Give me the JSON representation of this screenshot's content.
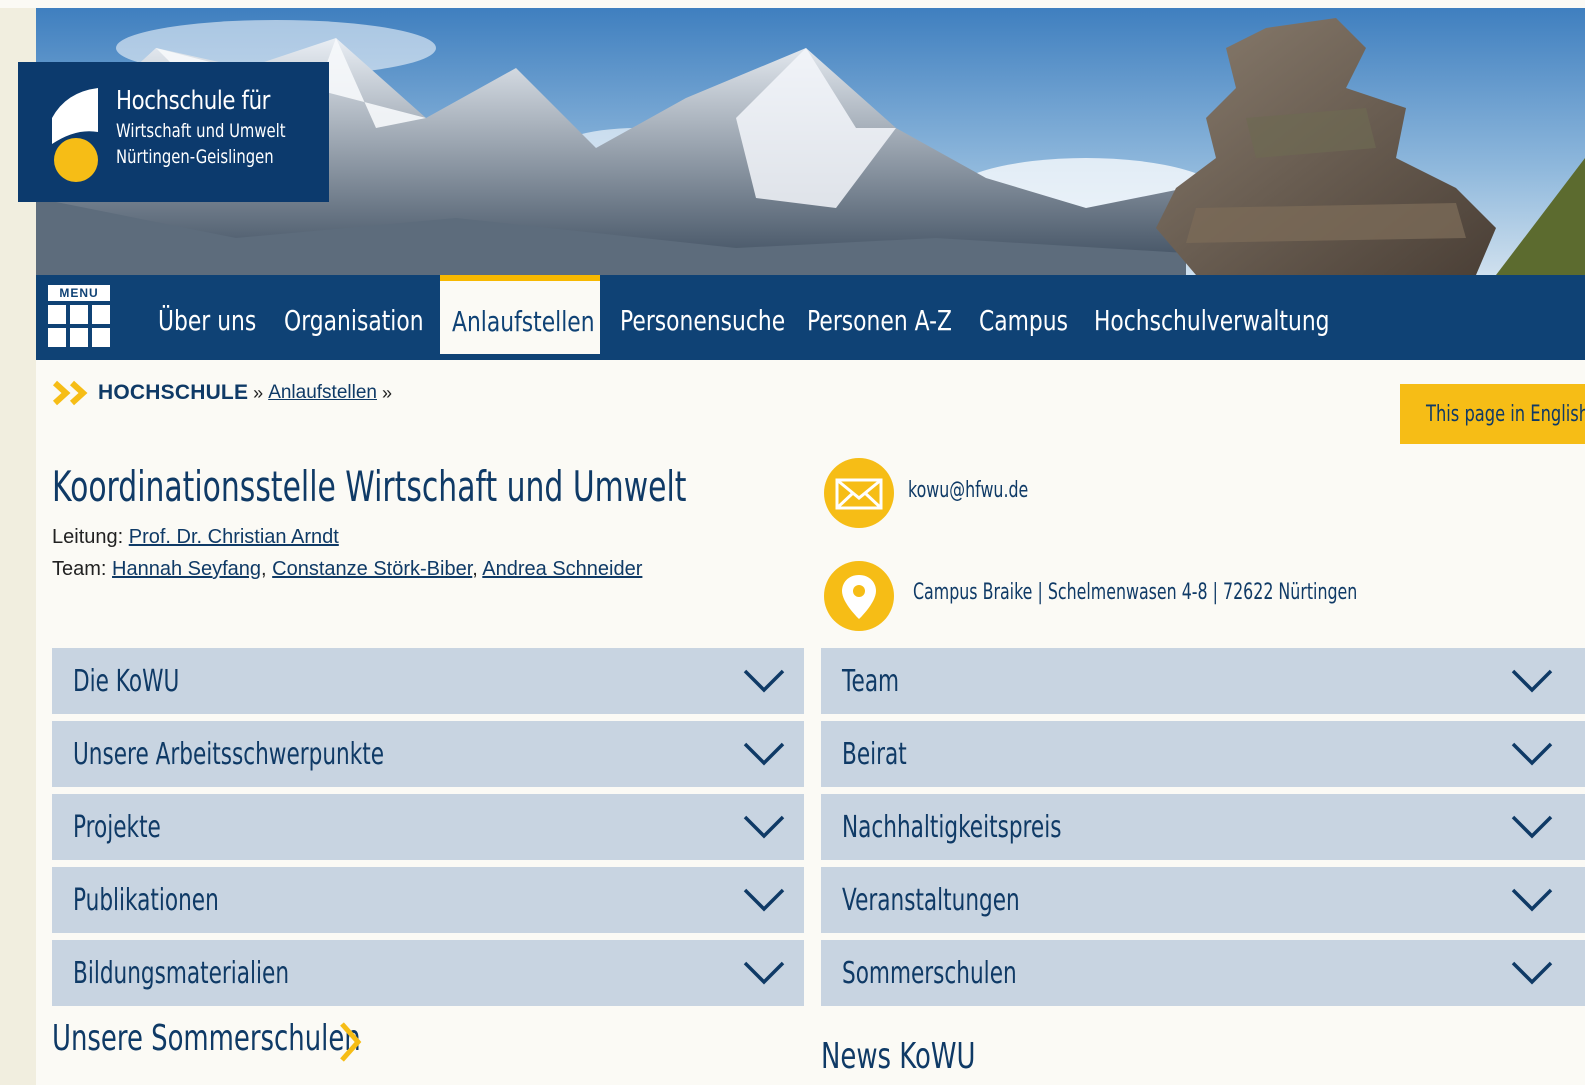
{
  "logo": {
    "line1": "Hochschule für",
    "line2": "Wirtschaft und Umwelt",
    "line3": "Nürtingen-Geislingen"
  },
  "nav": {
    "menu_label": "MENU",
    "items": [
      {
        "label": "Über uns"
      },
      {
        "label": "Organisation"
      },
      {
        "label": "Anlaufstellen"
      },
      {
        "label": "Personensuche"
      },
      {
        "label": "Personen A-Z"
      },
      {
        "label": "Campus"
      },
      {
        "label": "Hochschulverwaltung"
      }
    ],
    "active_index": 2
  },
  "breadcrumb": {
    "home": "HOCHSCHULE",
    "separator": "»",
    "current": "Anlaufstellen"
  },
  "english_link": "This page in English",
  "page": {
    "title": "Koordinationsstelle Wirtschaft und Umwelt",
    "lead_label": "Leitung:",
    "lead_name": "Prof. Dr. Christian Arndt",
    "team_label": "Team:",
    "team": [
      "Hannah Seyfang",
      "Constanze Störk-Biber",
      "Andrea Schneider"
    ],
    "team_sep": ","
  },
  "contact": {
    "email": "kowu@hfwu.de",
    "address": "Campus Braike | Schelmenwasen 4-8 | 72622 Nürtingen",
    "email_icon": "mail-icon",
    "address_icon": "map-pin-icon"
  },
  "accordion_left": [
    {
      "label": "Die KoWU"
    },
    {
      "label": "Unsere Arbeitsschwerpunkte"
    },
    {
      "label": "Projekte"
    },
    {
      "label": "Publikationen"
    },
    {
      "label": "Bildungsmaterialien"
    }
  ],
  "accordion_right": [
    {
      "label": "Team"
    },
    {
      "label": "Beirat"
    },
    {
      "label": "Nachhaltigkeitspreis"
    },
    {
      "label": "Veranstaltungen"
    },
    {
      "label": "Sommerschulen"
    }
  ],
  "sections": {
    "summer_schools_link": "Unsere Sommerschulen",
    "news_heading": "News KoWU"
  },
  "colors": {
    "brand_blue": "#0f4275",
    "accent_yellow": "#f6bd16",
    "accordion_bg": "#c8d4e1"
  }
}
